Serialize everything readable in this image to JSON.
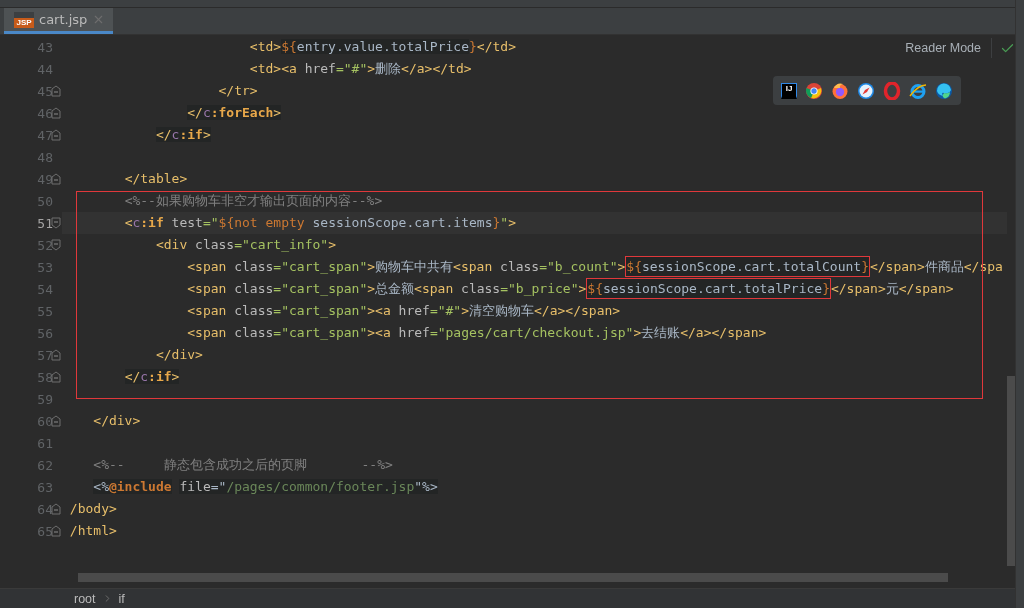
{
  "tabs": [
    {
      "label": "cart.jsp",
      "icon_label": "JSP",
      "selected": true
    }
  ],
  "editor": {
    "reader_mode": "Reader Mode",
    "browser_popup": {
      "ide_logo_label": "IJ",
      "browsers": [
        {
          "kind": "tricolor"
        },
        {
          "kind": "flame"
        },
        {
          "kind": "compass"
        },
        {
          "kind": "ring"
        },
        {
          "kind": "letter_e"
        },
        {
          "kind": "swirl"
        }
      ]
    },
    "lines": [
      {
        "number": "43",
        "current": false,
        "kind": "plain",
        "tokens": [
          {
            "kind": "tag",
            "text": "                        <td>"
          },
          {
            "kind": "highlight",
            "parts": [
              {
                "kind": "el",
                "text": "${"
              },
              {
                "kind": "expr",
                "text": "entry.value.totalPrice"
              }
            ]
          },
          {
            "kind": "el",
            "text": "}"
          },
          {
            "kind": "tag",
            "text": "</td>"
          }
        ]
      },
      {
        "number": "44",
        "current": false,
        "kind": "plain",
        "tokens": [
          {
            "kind": "tag",
            "text": "                        <td><a "
          },
          {
            "kind": "attr",
            "text": "href"
          },
          {
            "kind": "str",
            "text": "=\"#\""
          },
          {
            "kind": "tag",
            "text": ">"
          },
          {
            "kind": "text",
            "text": "删除"
          },
          {
            "kind": "tag",
            "text": "</a></td>"
          }
        ]
      },
      {
        "number": "45",
        "current": false,
        "kind": "fold_end",
        "tokens": [
          {
            "kind": "tag",
            "text": "                    </tr>"
          }
        ]
      },
      {
        "number": "46",
        "current": false,
        "kind": "fold_end",
        "tokens": [
          {
            "kind": "highlight",
            "parts": [
              {
                "kind": "tag",
                "text": "                </"
              },
              {
                "kind": "ns",
                "text": "c"
              },
              {
                "kind": "tagb",
                "text": ":forEach"
              },
              {
                "kind": "tag",
                "text": ">"
              }
            ]
          }
        ]
      },
      {
        "number": "47",
        "current": false,
        "kind": "fold_end",
        "tokens": [
          {
            "kind": "highlight",
            "parts": [
              {
                "kind": "tag",
                "text": "            </"
              },
              {
                "kind": "ns",
                "text": "c"
              },
              {
                "kind": "tagb",
                "text": ":if"
              },
              {
                "kind": "tag",
                "text": ">"
              }
            ]
          }
        ]
      },
      {
        "number": "48",
        "current": false,
        "kind": "plain"
      },
      {
        "number": "49",
        "current": false,
        "kind": "fold_end",
        "tokens": [
          {
            "kind": "tag",
            "text": "        </table>"
          }
        ]
      },
      {
        "number": "50",
        "current": false,
        "kind": "plain",
        "tokens": [
          {
            "kind": "cmt",
            "text": "        <%--如果购物车非空才输出页面的内容--%>"
          }
        ]
      },
      {
        "number": "51",
        "current": true,
        "kind": "fold_start",
        "tokens": [
          {
            "kind": "tag",
            "text": "        <"
          },
          {
            "kind": "ns",
            "text": "c"
          },
          {
            "kind": "tagb",
            "text": ":if"
          },
          {
            "kind": "attr",
            "text": " test"
          },
          {
            "kind": "str",
            "text": "=\""
          },
          {
            "kind": "el",
            "text": "${not empty"
          },
          {
            "kind": "expr",
            "text": " sessionScope.cart.items"
          },
          {
            "kind": "el",
            "text": "}"
          },
          {
            "kind": "str",
            "text": "\""
          },
          {
            "kind": "tag",
            "text": ">"
          }
        ]
      },
      {
        "number": "52",
        "current": false,
        "kind": "fold_start",
        "tokens": [
          {
            "kind": "tag",
            "text": "            <div "
          },
          {
            "kind": "attr",
            "text": "class"
          },
          {
            "kind": "str",
            "text": "=\"cart_info\""
          },
          {
            "kind": "tag",
            "text": ">"
          }
        ]
      },
      {
        "number": "53",
        "current": false,
        "kind": "plain",
        "tokens": [
          {
            "kind": "tag",
            "text": "                <span "
          },
          {
            "kind": "attr",
            "text": "class"
          },
          {
            "kind": "str",
            "text": "=\"cart_span\""
          },
          {
            "kind": "tag",
            "text": ">"
          },
          {
            "kind": "text",
            "text": "购物车中共有"
          },
          {
            "kind": "tag",
            "text": "<span "
          },
          {
            "kind": "attr",
            "text": "class"
          },
          {
            "kind": "str",
            "text": "=\"b_count\""
          },
          {
            "kind": "tag",
            "text": ">"
          },
          {
            "kind": "boxed",
            "parts": [
              {
                "kind": "el",
                "text": "${"
              },
              {
                "kind": "expr",
                "text": "sessionScope.cart.totalCount"
              },
              {
                "kind": "el",
                "text": "}"
              }
            ]
          },
          {
            "kind": "tag",
            "text": "</span>"
          },
          {
            "kind": "text",
            "text": "件商品"
          },
          {
            "kind": "tag",
            "text": "</spa"
          }
        ]
      },
      {
        "number": "54",
        "current": false,
        "kind": "plain",
        "tokens": [
          {
            "kind": "tag",
            "text": "                <span "
          },
          {
            "kind": "attr",
            "text": "class"
          },
          {
            "kind": "str",
            "text": "=\"cart_span\""
          },
          {
            "kind": "tag",
            "text": ">"
          },
          {
            "kind": "text",
            "text": "总金额"
          },
          {
            "kind": "tag",
            "text": "<span "
          },
          {
            "kind": "attr",
            "text": "class"
          },
          {
            "kind": "str",
            "text": "=\"b_price\""
          },
          {
            "kind": "tag",
            "text": ">"
          },
          {
            "kind": "boxed",
            "parts": [
              {
                "kind": "el",
                "text": "${"
              },
              {
                "kind": "expr",
                "text": "sessionScope.cart.totalPrice"
              },
              {
                "kind": "el",
                "text": "}"
              }
            ]
          },
          {
            "kind": "tag",
            "text": "</span>"
          },
          {
            "kind": "text",
            "text": "元"
          },
          {
            "kind": "tag",
            "text": "</span>"
          }
        ]
      },
      {
        "number": "55",
        "current": false,
        "kind": "plain",
        "tokens": [
          {
            "kind": "tag",
            "text": "                <span "
          },
          {
            "kind": "attr",
            "text": "class"
          },
          {
            "kind": "str",
            "text": "=\"cart_span\""
          },
          {
            "kind": "tag",
            "text": "><a "
          },
          {
            "kind": "attr",
            "text": "href"
          },
          {
            "kind": "str",
            "text": "=\"#\""
          },
          {
            "kind": "tag",
            "text": ">"
          },
          {
            "kind": "text",
            "text": "清空购物车"
          },
          {
            "kind": "tag",
            "text": "</a></span>"
          }
        ]
      },
      {
        "number": "56",
        "current": false,
        "kind": "plain",
        "tokens": [
          {
            "kind": "tag",
            "text": "                <span "
          },
          {
            "kind": "attr",
            "text": "class"
          },
          {
            "kind": "str",
            "text": "=\"cart_span\""
          },
          {
            "kind": "tag",
            "text": "><a "
          },
          {
            "kind": "attr",
            "text": "href"
          },
          {
            "kind": "str",
            "text": "=\"pages/cart/checkout.jsp\""
          },
          {
            "kind": "tag",
            "text": ">"
          },
          {
            "kind": "text",
            "text": "去结账"
          },
          {
            "kind": "tag",
            "text": "</a></span>"
          }
        ]
      },
      {
        "number": "57",
        "current": false,
        "kind": "fold_end",
        "tokens": [
          {
            "kind": "tag",
            "text": "            </div>"
          }
        ]
      },
      {
        "number": "58",
        "current": false,
        "kind": "fold_end",
        "tokens": [
          {
            "kind": "highlight",
            "parts": [
              {
                "kind": "tag",
                "text": "        </"
              },
              {
                "kind": "ns",
                "text": "c"
              },
              {
                "kind": "tagb",
                "text": ":if"
              },
              {
                "kind": "tag",
                "text": ">"
              }
            ]
          }
        ]
      },
      {
        "number": "59",
        "current": false,
        "kind": "plain"
      },
      {
        "number": "60",
        "current": false,
        "kind": "fold_end",
        "tokens": [
          {
            "kind": "tag",
            "text": "    </div>"
          }
        ]
      },
      {
        "number": "61",
        "current": false,
        "kind": "plain"
      },
      {
        "number": "62",
        "current": false,
        "kind": "plain",
        "tokens": [
          {
            "kind": "cmt",
            "text": "    <%--     静态包含成功之后的页脚       --%>"
          }
        ]
      },
      {
        "number": "63",
        "current": false,
        "kind": "plain",
        "tokens": [
          {
            "kind": "highlight",
            "parts": [
              {
                "kind": "text",
                "text": "    <%"
              },
              {
                "kind": "dir",
                "text": "@include"
              },
              {
                "kind": "attr",
                "text": " file"
              },
              {
                "kind": "text",
                "text": "=\""
              },
              {
                "kind": "path",
                "text": "/pages/common/footer.jsp"
              },
              {
                "kind": "text",
                "text": "\"%>"
              }
            ]
          }
        ]
      },
      {
        "number": "64",
        "current": false,
        "kind": "fold_end",
        "tokens": [
          {
            "kind": "tag",
            "text": " /body>"
          }
        ]
      },
      {
        "number": "65",
        "current": false,
        "kind": "fold_end",
        "tokens": [
          {
            "kind": "tag",
            "text": " /html>"
          }
        ]
      }
    ]
  },
  "breadcrumbs": [
    {
      "label": "root"
    },
    {
      "label": "if"
    }
  ]
}
